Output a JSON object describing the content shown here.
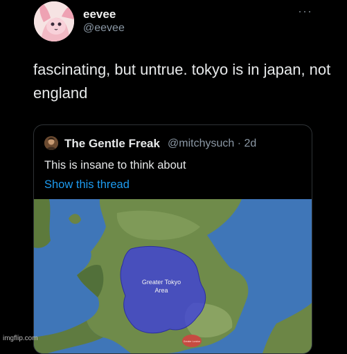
{
  "tweet": {
    "display_name": "eevee",
    "handle": "@eevee",
    "more_icon": "more-dots-icon",
    "text": "fascinating, but untrue.  tokyo is in japan, not england"
  },
  "quoted_tweet": {
    "display_name": "The Gentle Freak",
    "handle": "@mitchysuch",
    "time": "· 2d",
    "text": "This is insane to think about",
    "show_thread": "Show this thread",
    "map": {
      "overlay_label_line1": "Greater Tokyo",
      "overlay_label_line2": "Area",
      "overlay_color": "#3d3fdc",
      "small_label": "Greater London"
    }
  },
  "watermark": "imgflip.com"
}
